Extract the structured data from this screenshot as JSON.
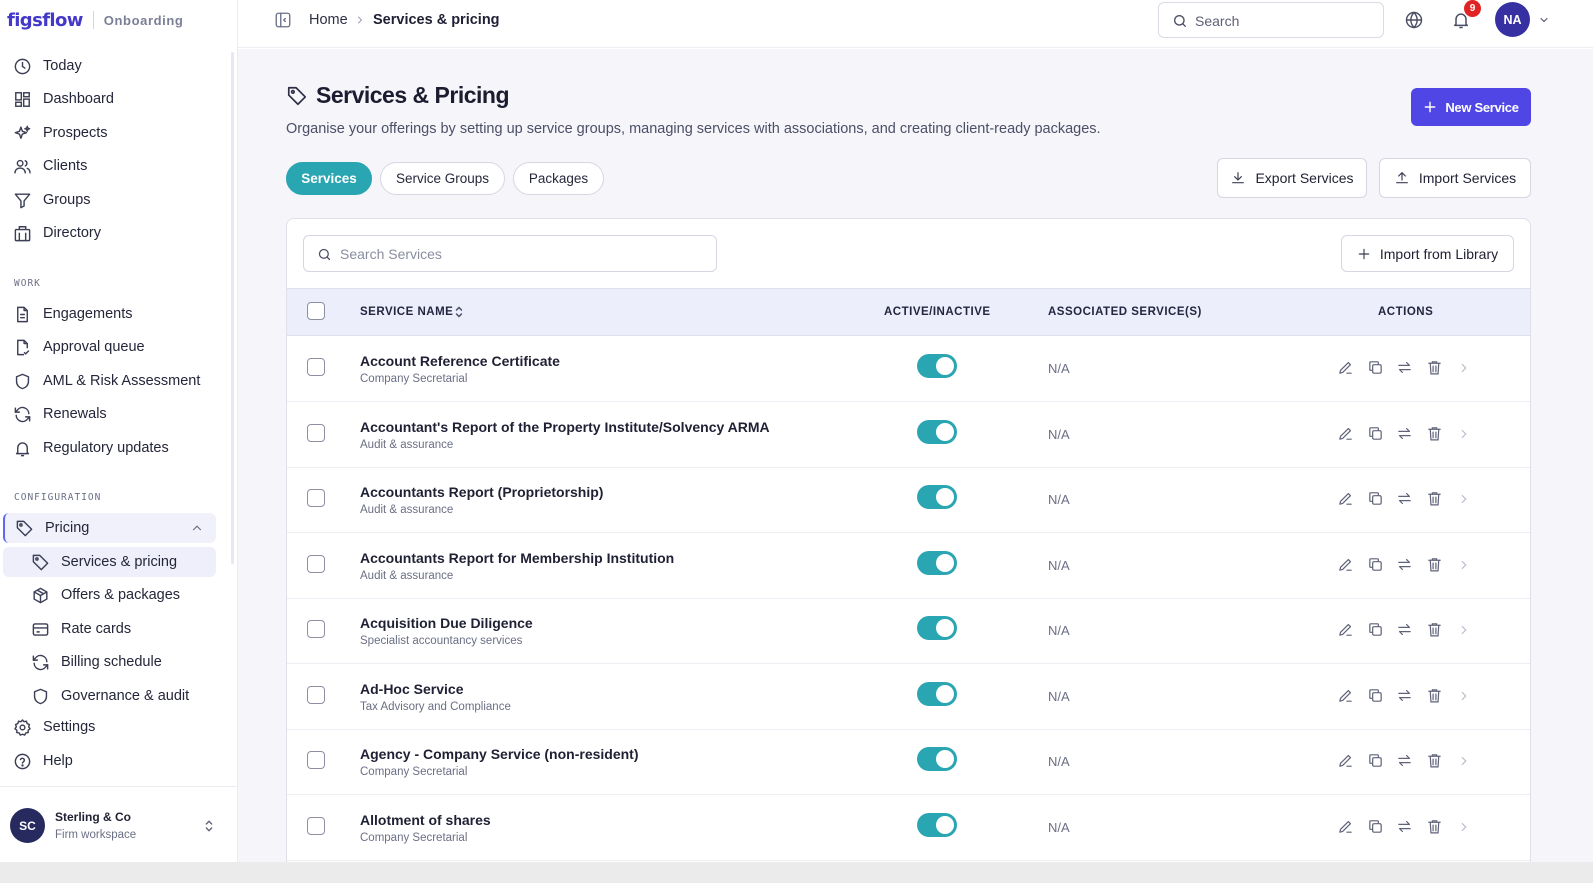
{
  "brand": {
    "logo": "figsflow",
    "subtitle": "Onboarding"
  },
  "sidebar": {
    "main_items": [
      {
        "label": "Today",
        "icon": "clock-icon"
      },
      {
        "label": "Dashboard",
        "icon": "dashboard-icon"
      },
      {
        "label": "Prospects",
        "icon": "sparkles-icon"
      },
      {
        "label": "Clients",
        "icon": "users-icon"
      },
      {
        "label": "Groups",
        "icon": "filter-icon"
      },
      {
        "label": "Directory",
        "icon": "building-icon"
      }
    ],
    "work_label": "WORK",
    "work_items": [
      {
        "label": "Engagements",
        "icon": "document-icon"
      },
      {
        "label": "Approval queue",
        "icon": "document-check-icon"
      },
      {
        "label": "AML & Risk Assessment",
        "icon": "shield-icon"
      },
      {
        "label": "Renewals",
        "icon": "refresh-icon"
      },
      {
        "label": "Regulatory updates",
        "icon": "bell-icon"
      }
    ],
    "config_label": "CONFIGURATION",
    "pricing": {
      "label": "Pricing",
      "icon": "tag-icon"
    },
    "pricing_children": [
      {
        "label": "Services & pricing",
        "icon": "tag-icon"
      },
      {
        "label": "Offers & packages",
        "icon": "package-icon"
      },
      {
        "label": "Rate cards",
        "icon": "card-icon"
      },
      {
        "label": "Billing schedule",
        "icon": "refresh-icon"
      },
      {
        "label": "Governance & audit",
        "icon": "shield-icon"
      }
    ],
    "bottom_items": [
      {
        "label": "Settings",
        "icon": "gear-icon"
      },
      {
        "label": "Help",
        "icon": "help-icon"
      }
    ],
    "workspace": {
      "initials": "SC",
      "name": "Sterling & Co",
      "type": "Firm workspace"
    }
  },
  "topbar": {
    "breadcrumb_home": "Home",
    "breadcrumb_current": "Services & pricing",
    "search_placeholder": "Search",
    "notification_count": "9",
    "user_initials": "NA"
  },
  "page": {
    "title": "Services & Pricing",
    "description": "Organise your offerings by setting up service groups, managing services with associations, and creating client-ready packages.",
    "new_button": "New Service",
    "tabs": [
      {
        "label": "Services",
        "active": true
      },
      {
        "label": "Service Groups",
        "active": false
      },
      {
        "label": "Packages",
        "active": false
      }
    ],
    "export_button": "Export Services",
    "import_button": "Import Services",
    "search_placeholder": "Search Services",
    "library_button": "Import from Library"
  },
  "table": {
    "columns": {
      "name": "SERVICE NAME",
      "active": "ACTIVE/INACTIVE",
      "associated": "ASSOCIATED SERVICE(S)",
      "actions": "ACTIONS"
    },
    "rows": [
      {
        "name": "Account Reference Certificate",
        "category": "Company Secretarial",
        "active": true,
        "associated": "N/A"
      },
      {
        "name": "Accountant's Report of the Property Institute/Solvency ARMA",
        "category": "Audit & assurance",
        "active": true,
        "associated": "N/A"
      },
      {
        "name": "Accountants Report (Proprietorship)",
        "category": "Audit & assurance",
        "active": true,
        "associated": "N/A"
      },
      {
        "name": "Accountants Report for Membership Institution",
        "category": "Audit & assurance",
        "active": true,
        "associated": "N/A"
      },
      {
        "name": "Acquisition Due Diligence",
        "category": "Specialist accountancy services",
        "active": true,
        "associated": "N/A"
      },
      {
        "name": "Ad-Hoc Service",
        "category": "Tax Advisory and Compliance",
        "active": true,
        "associated": "N/A"
      },
      {
        "name": "Agency - Company Service (non-resident)",
        "category": "Company Secretarial",
        "active": true,
        "associated": "N/A"
      },
      {
        "name": "Allotment of shares",
        "category": "Company Secretarial",
        "active": true,
        "associated": "N/A"
      }
    ]
  },
  "colors": {
    "brand": "#4338ca",
    "primary_button": "#4f46e5",
    "teal_active": "#2aa5b2",
    "table_header_bg": "#eceefc",
    "avatar_bg": "#3730a3"
  }
}
